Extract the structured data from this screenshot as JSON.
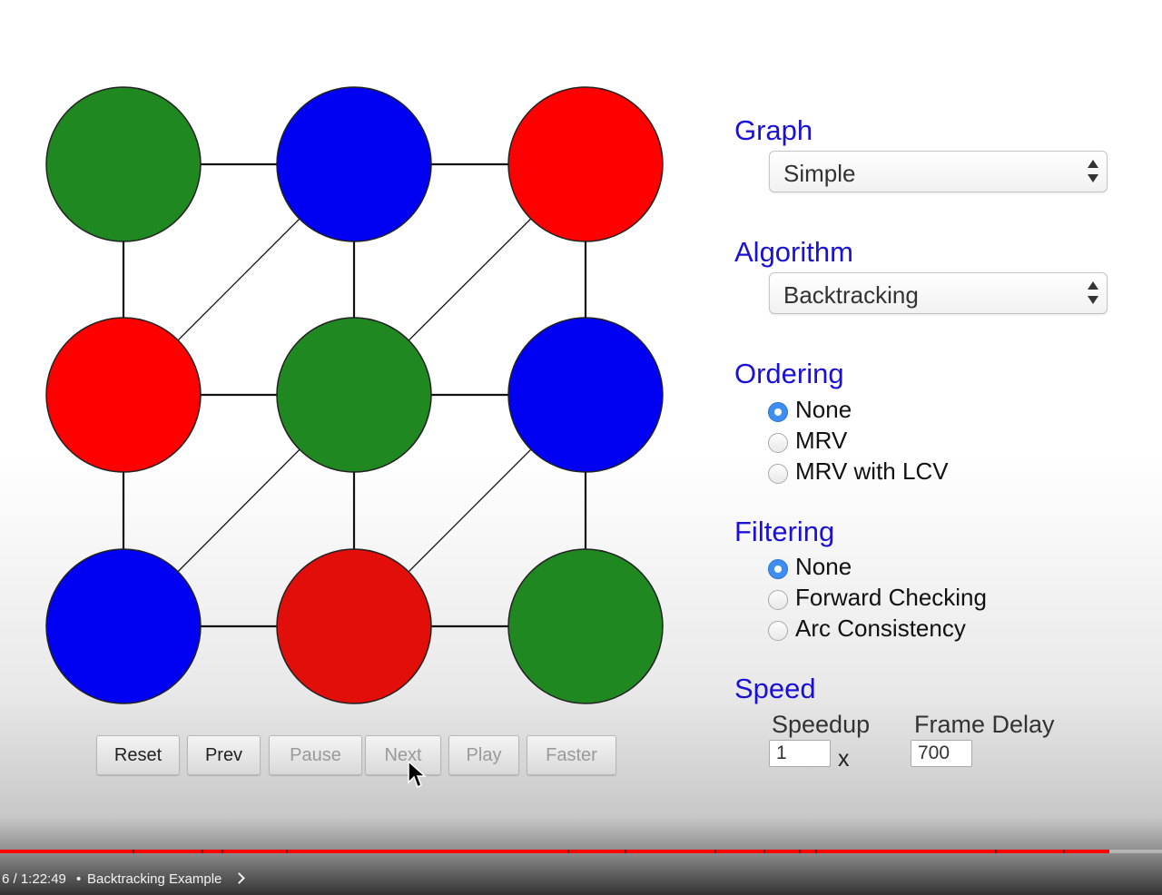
{
  "graph": {
    "colors": {
      "green": "#208820",
      "blue": "#0000f2",
      "red": "#ff0000",
      "dark_red": "#e10e0a"
    },
    "nodes": [
      {
        "id": "n1",
        "color": "green"
      },
      {
        "id": "n2",
        "color": "blue"
      },
      {
        "id": "n3",
        "color": "red"
      },
      {
        "id": "n4",
        "color": "red"
      },
      {
        "id": "n5",
        "color": "green"
      },
      {
        "id": "n6",
        "color": "blue"
      },
      {
        "id": "n7",
        "color": "blue"
      },
      {
        "id": "n8",
        "color": "dark_red"
      },
      {
        "id": "n9",
        "color": "green"
      }
    ],
    "edges": [
      [
        "n1",
        "n2"
      ],
      [
        "n2",
        "n3"
      ],
      [
        "n4",
        "n5"
      ],
      [
        "n5",
        "n6"
      ],
      [
        "n7",
        "n8"
      ],
      [
        "n8",
        "n9"
      ],
      [
        "n1",
        "n4"
      ],
      [
        "n4",
        "n7"
      ],
      [
        "n2",
        "n5"
      ],
      [
        "n5",
        "n8"
      ],
      [
        "n3",
        "n6"
      ],
      [
        "n6",
        "n9"
      ],
      [
        "n4",
        "n2"
      ],
      [
        "n5",
        "n3"
      ],
      [
        "n7",
        "n5"
      ],
      [
        "n8",
        "n6"
      ]
    ]
  },
  "controls": {
    "reset": "Reset",
    "prev": "Prev",
    "pause": "Pause",
    "next": "Next",
    "play": "Play",
    "faster": "Faster"
  },
  "panel": {
    "graph": {
      "title": "Graph",
      "selected": "Simple"
    },
    "algorithm": {
      "title": "Algorithm",
      "selected": "Backtracking"
    },
    "ordering": {
      "title": "Ordering",
      "options": [
        "None",
        "MRV",
        "MRV with LCV"
      ],
      "selected": "None"
    },
    "filtering": {
      "title": "Filtering",
      "options": [
        "None",
        "Forward Checking",
        "Arc Consistency"
      ],
      "selected": "None"
    },
    "speed": {
      "title": "Speed",
      "speedup_label": "Speedup",
      "speedup_value": "1",
      "times": "x",
      "frame_delay_label": "Frame Delay",
      "frame_delay_value": "700"
    }
  },
  "video": {
    "time": "6 / 1:22:49",
    "separator": "•",
    "chapter": "Backtracking Example",
    "progress_fraction": 0.955,
    "accent": "#ff0000"
  }
}
